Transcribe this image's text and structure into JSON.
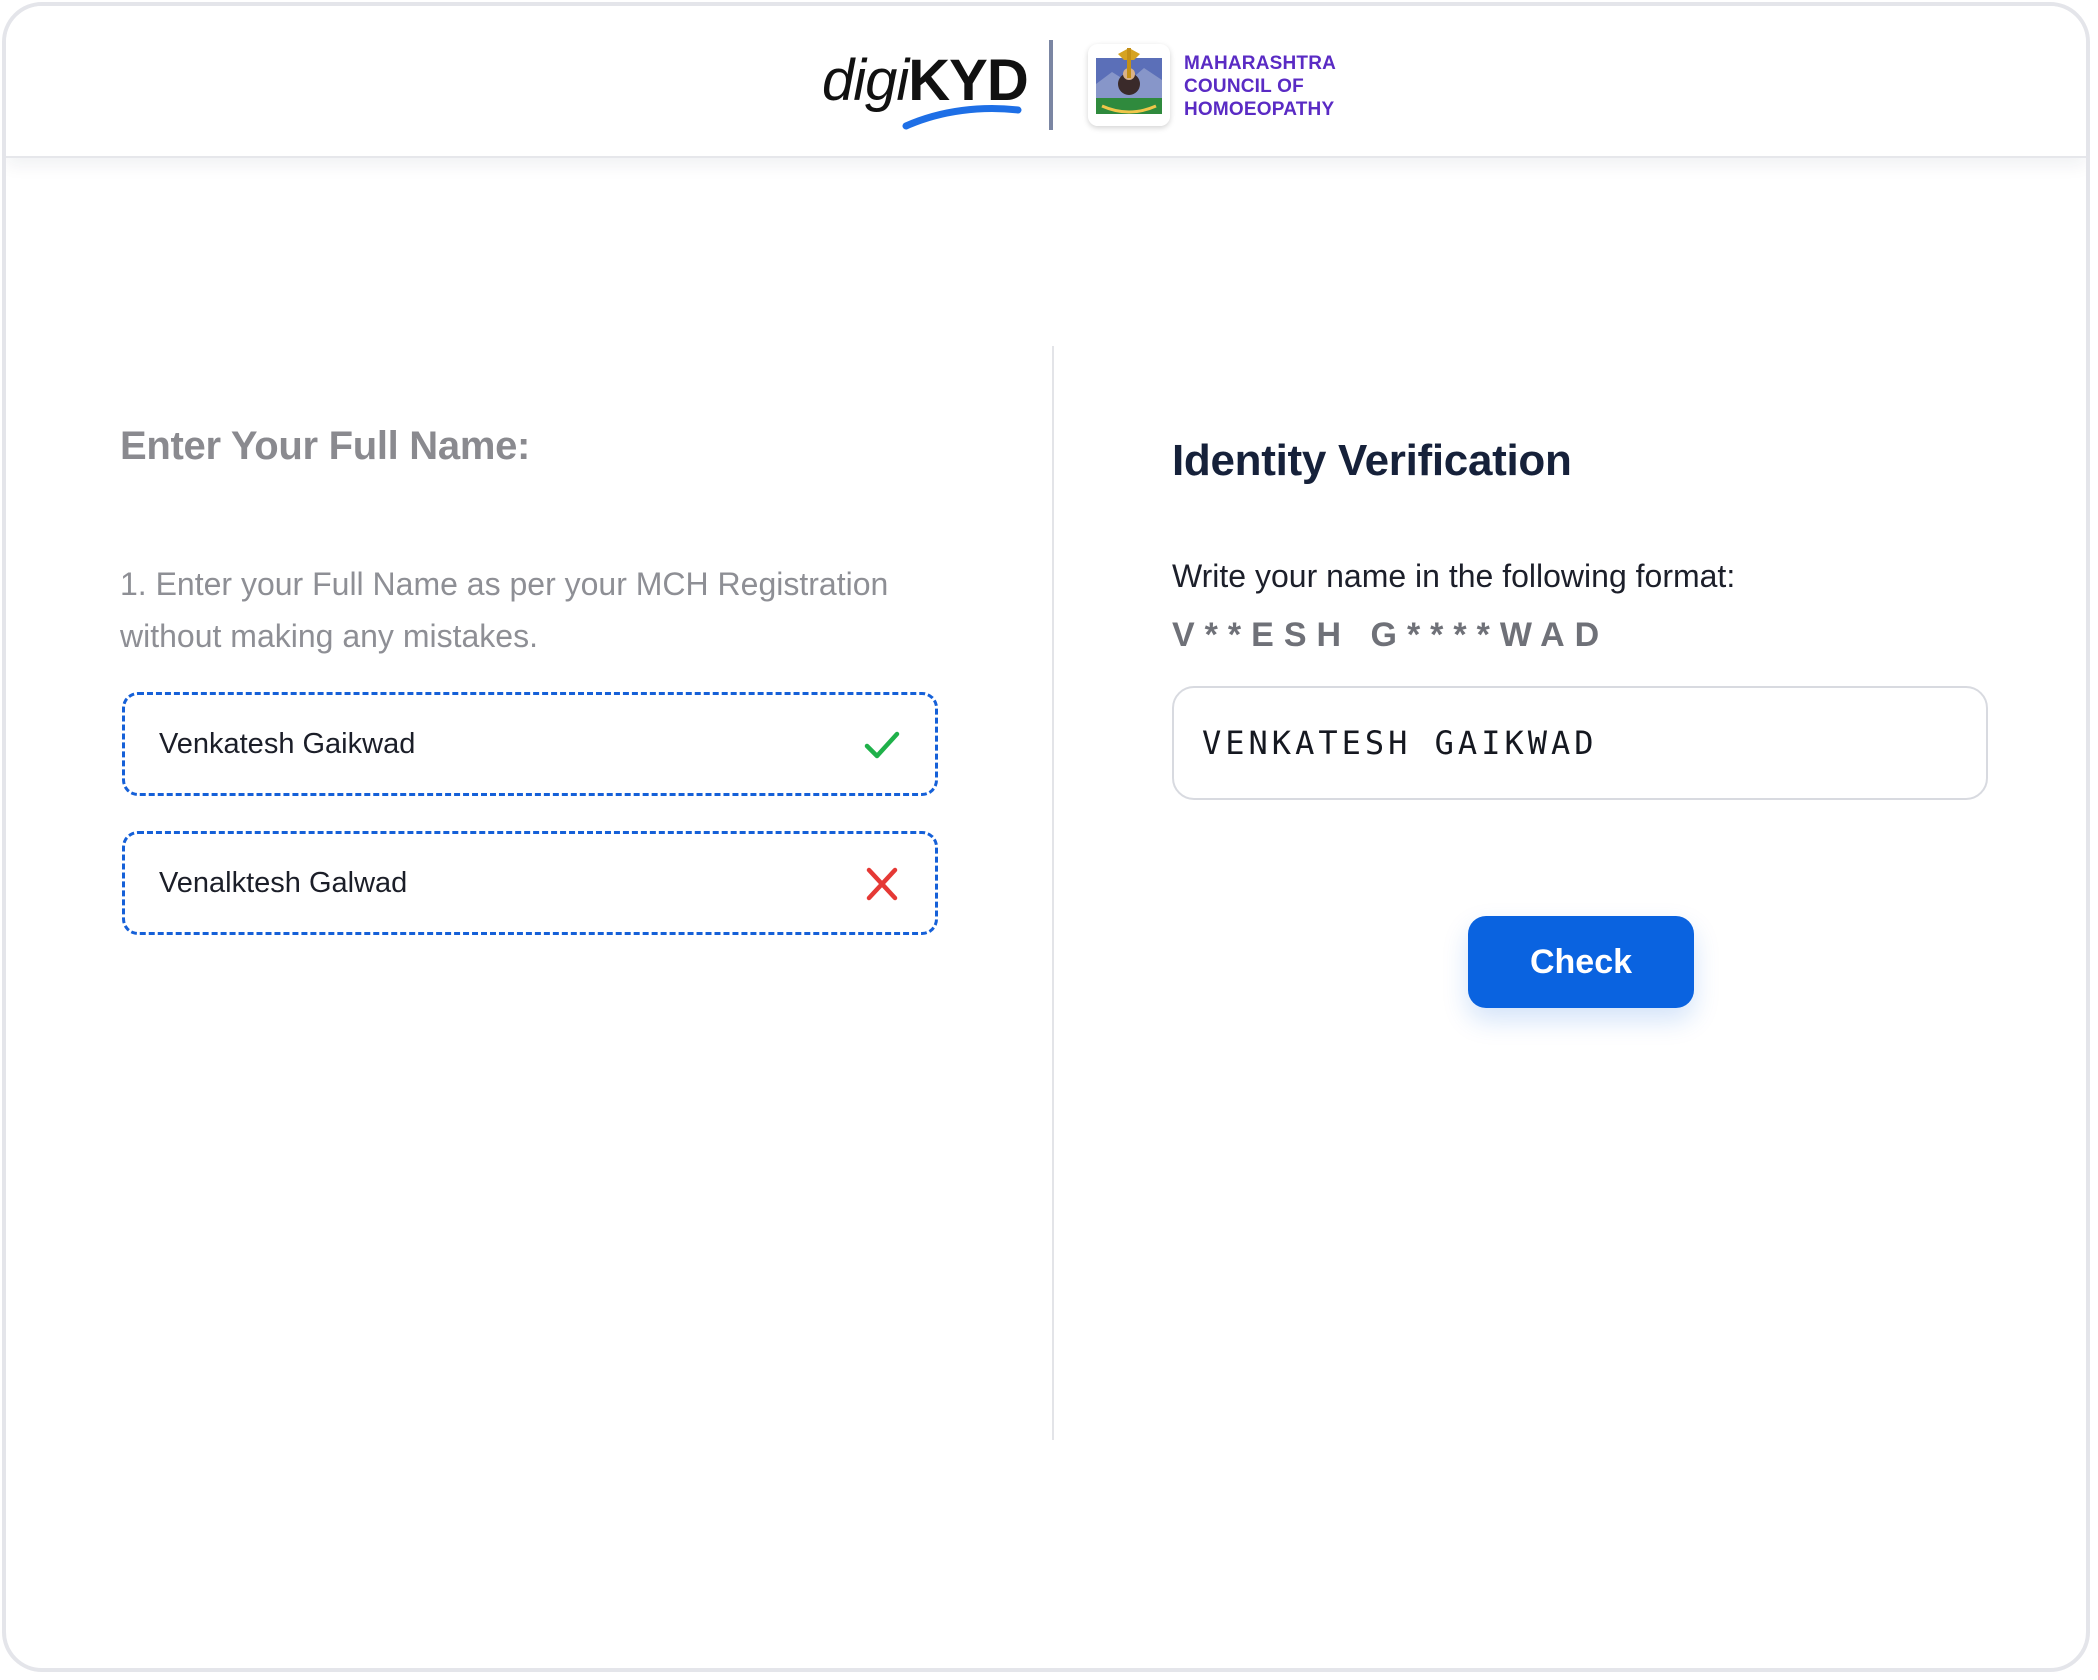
{
  "header": {
    "brand_prefix": "digi",
    "brand_suffix": "KYD",
    "council_lines": [
      "MAHARASHTRA",
      "COUNCIL OF",
      "HOMOEOPATHY"
    ]
  },
  "left_panel": {
    "title": "Enter Your Full Name:",
    "instruction": "1. Enter your Full Name as per your MCH Registration without making any mistakes.",
    "options": [
      {
        "label": "Venkatesh Gaikwad",
        "status_icon": "check-icon",
        "status": "correct"
      },
      {
        "label": "Venalktesh Galwad",
        "status_icon": "close-icon",
        "status": "incorrect"
      }
    ]
  },
  "right_panel": {
    "title": "Identity Verification",
    "format_label": "Write your name in the following format:",
    "format_mask": "V**ESH G****WAD",
    "input_value": "VENKATESH GAIKWAD",
    "button_label": "Check"
  },
  "colors": {
    "accent": "#0a63e0",
    "dashed_border": "#1560d8",
    "success": "#1fb14a",
    "error": "#e53935",
    "council_text": "#5a2bc4"
  }
}
